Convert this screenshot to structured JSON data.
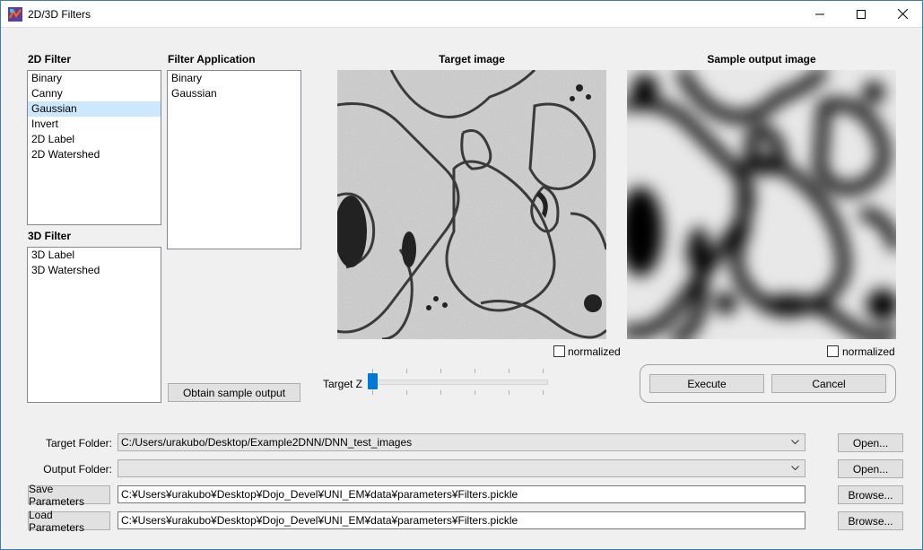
{
  "window": {
    "title": "2D/3D Filters"
  },
  "filters_2d": {
    "label": "2D Filter",
    "items": [
      "Binary",
      "Canny",
      "Gaussian",
      "Invert",
      "2D Label",
      "2D Watershed"
    ],
    "selected": "Gaussian"
  },
  "filters_3d": {
    "label": "3D Filter",
    "items": [
      "3D Label",
      "3D Watershed"
    ]
  },
  "filter_application": {
    "label": "Filter Application",
    "items": [
      "Binary",
      "Gaussian"
    ]
  },
  "obtain_button": "Obtain sample output",
  "target_image": {
    "title": "Target image",
    "normalized_label": "normalized",
    "normalized_checked": false
  },
  "sample_image": {
    "title": "Sample output image",
    "normalized_label": "normalized",
    "normalized_checked": false
  },
  "target_z": {
    "label": "Target Z",
    "value_fraction": 0.0
  },
  "execute_button": "Execute",
  "cancel_button": "Cancel",
  "target_folder": {
    "label": "Target Folder:",
    "value": "C:/Users/urakubo/Desktop/Example2DNN/DNN_test_images",
    "button": "Open..."
  },
  "output_folder": {
    "label": "Output Folder:",
    "value": "",
    "button": "Open..."
  },
  "save_parameters": {
    "button": "Save Parameters",
    "value": "C:¥Users¥urakubo¥Desktop¥Dojo_Devel¥UNI_EM¥data¥parameters¥Filters.pickle",
    "browse": "Browse..."
  },
  "load_parameters": {
    "button": "Load Parameters",
    "value": "C:¥Users¥urakubo¥Desktop¥Dojo_Devel¥UNI_EM¥data¥parameters¥Filters.pickle",
    "browse": "Browse..."
  },
  "icons": {
    "app": "app-filter-icon",
    "minimize": "minimize-icon",
    "maximize": "maximize-icon",
    "close": "close-icon",
    "dropdown": "chevron-down-icon"
  }
}
